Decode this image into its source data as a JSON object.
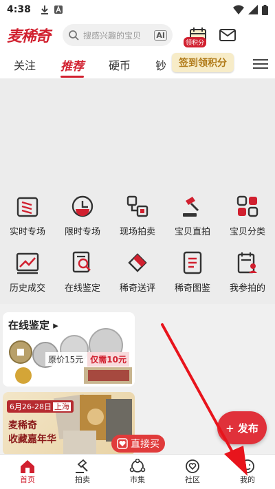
{
  "status": {
    "time": "4:38"
  },
  "header": {
    "logo": "麦稀奇",
    "search_placeholder": "搜感兴趣的宝贝",
    "ai_label": "AI",
    "points_badge": "领积分"
  },
  "tabs": [
    {
      "label": "关注"
    },
    {
      "label": "推荐"
    },
    {
      "label": "硬币"
    },
    {
      "label": "钞"
    }
  ],
  "signin_badge": "签到领积分",
  "grid": [
    {
      "label": "实时专场"
    },
    {
      "label": "限时专场"
    },
    {
      "label": "现场拍卖"
    },
    {
      "label": "宝贝直拍"
    },
    {
      "label": "宝贝分类"
    },
    {
      "label": "历史成交"
    },
    {
      "label": "在线鉴定"
    },
    {
      "label": "稀奇送评"
    },
    {
      "label": "稀奇图鉴"
    },
    {
      "label": "我参拍的"
    }
  ],
  "card1": {
    "title": "在线鉴定",
    "orig_price": "原价15元",
    "now_price": "仅需10元"
  },
  "card2": {
    "date": "6月26-28日",
    "place": "上海",
    "line1": "麦稀奇",
    "line2": "收藏嘉年华"
  },
  "buy_button": "直接买",
  "publish_button": "+ 发布",
  "bottom_nav": [
    {
      "label": "首页"
    },
    {
      "label": "拍卖"
    },
    {
      "label": "市集"
    },
    {
      "label": "社区"
    },
    {
      "label": "我的"
    }
  ],
  "colors": {
    "brand": "#d1202f",
    "gold": "#b07a18"
  }
}
